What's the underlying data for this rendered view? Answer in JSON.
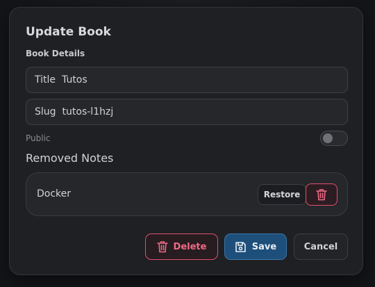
{
  "modal": {
    "title": "Update Book",
    "section_label": "Book Details"
  },
  "fields": {
    "title_label": "Title",
    "title_value": "Tutos",
    "slug_label": "Slug",
    "slug_value": "tutos-l1hzj"
  },
  "public": {
    "label": "Public",
    "enabled": false
  },
  "removed_notes": {
    "heading": "Removed Notes",
    "items": [
      {
        "name": "Docker",
        "restore_label": "Restore"
      }
    ]
  },
  "footer": {
    "delete_label": "Delete",
    "save_label": "Save",
    "cancel_label": "Cancel"
  },
  "icons": {
    "trash": "trash-icon",
    "save": "save-icon"
  },
  "colors": {
    "danger": "#e0506e",
    "primary": "#1d4f7a",
    "background": "#1f2023"
  }
}
